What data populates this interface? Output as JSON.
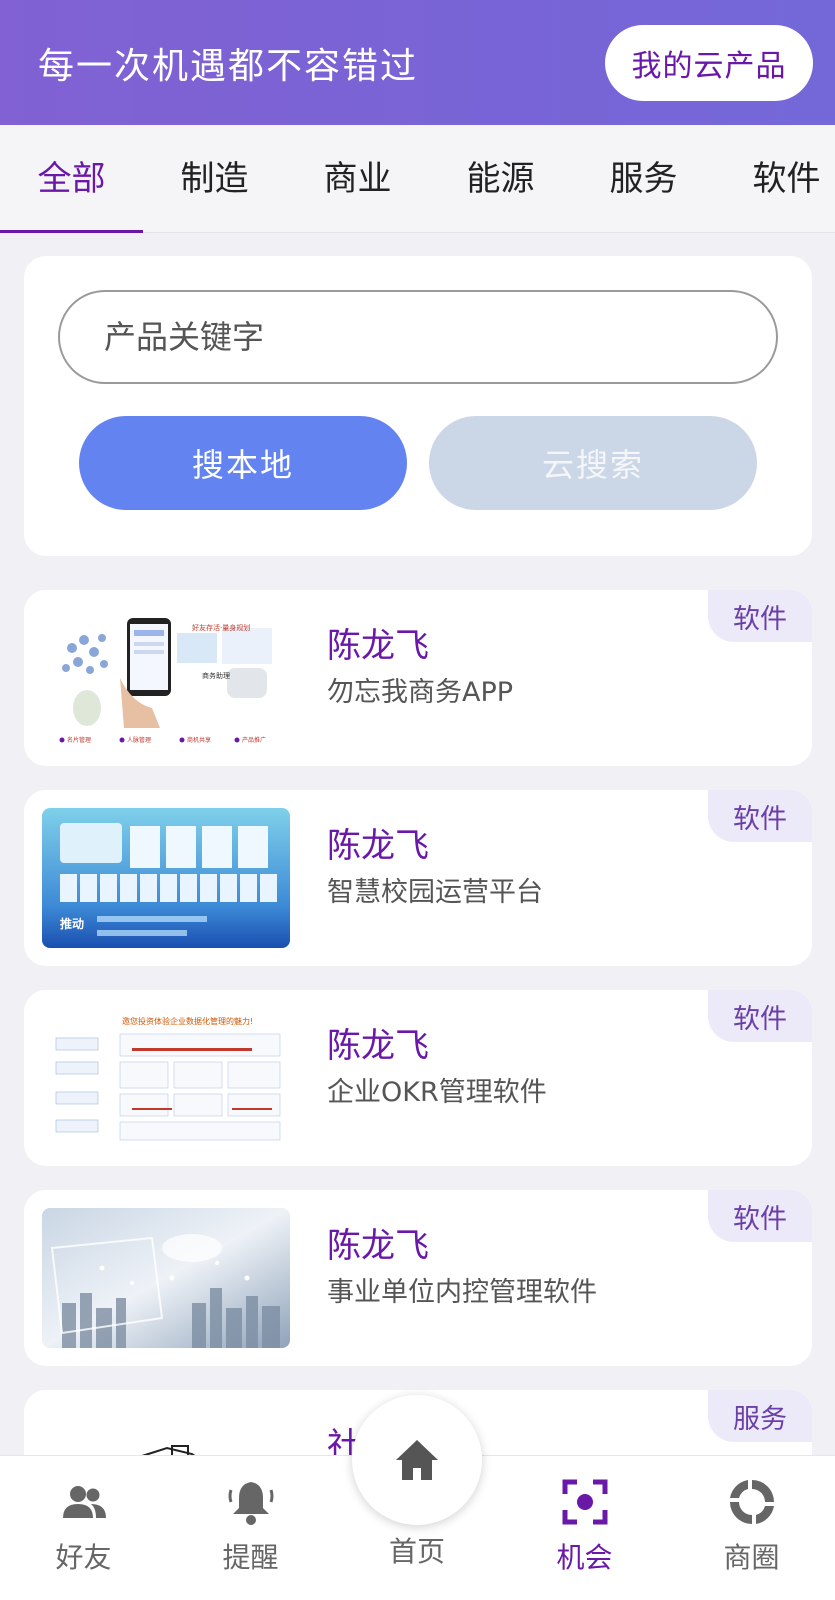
{
  "header": {
    "title": "每一次机遇都不容错过",
    "my_products_label": "我的云产品"
  },
  "tabs": [
    {
      "label": "全部",
      "active": true
    },
    {
      "label": "制造",
      "active": false
    },
    {
      "label": "商业",
      "active": false
    },
    {
      "label": "能源",
      "active": false
    },
    {
      "label": "服务",
      "active": false
    },
    {
      "label": "软件",
      "active": false
    }
  ],
  "search": {
    "placeholder": "产品关键字",
    "local_label": "搜本地",
    "cloud_label": "云搜索"
  },
  "items": [
    {
      "name": "陈龙飞",
      "desc": "勿忘我商务APP",
      "tag": "软件"
    },
    {
      "name": "陈龙飞",
      "desc": "智慧校园运营平台",
      "tag": "软件"
    },
    {
      "name": "陈龙飞",
      "desc": "企业OKR管理软件",
      "tag": "软件"
    },
    {
      "name": "陈龙飞",
      "desc": "事业单位内控管理软件",
      "tag": "软件"
    },
    {
      "name": "社",
      "desc": "",
      "tag": "服务"
    }
  ],
  "thumb_text": {
    "school_title": "推动",
    "okr_title": "邀您投资体验企业数据化管理的魅力!"
  },
  "bottom_nav": {
    "friends": "好友",
    "remind": "提醒",
    "home": "首页",
    "opportunity": "机会",
    "circle": "商圈"
  },
  "colors": {
    "brand_purple": "#6a18a8",
    "header_gradient": "#7864d6",
    "local_button": "#6383f0",
    "cloud_button": "#cbd6e6",
    "tag_bg": "#ece9f8"
  }
}
